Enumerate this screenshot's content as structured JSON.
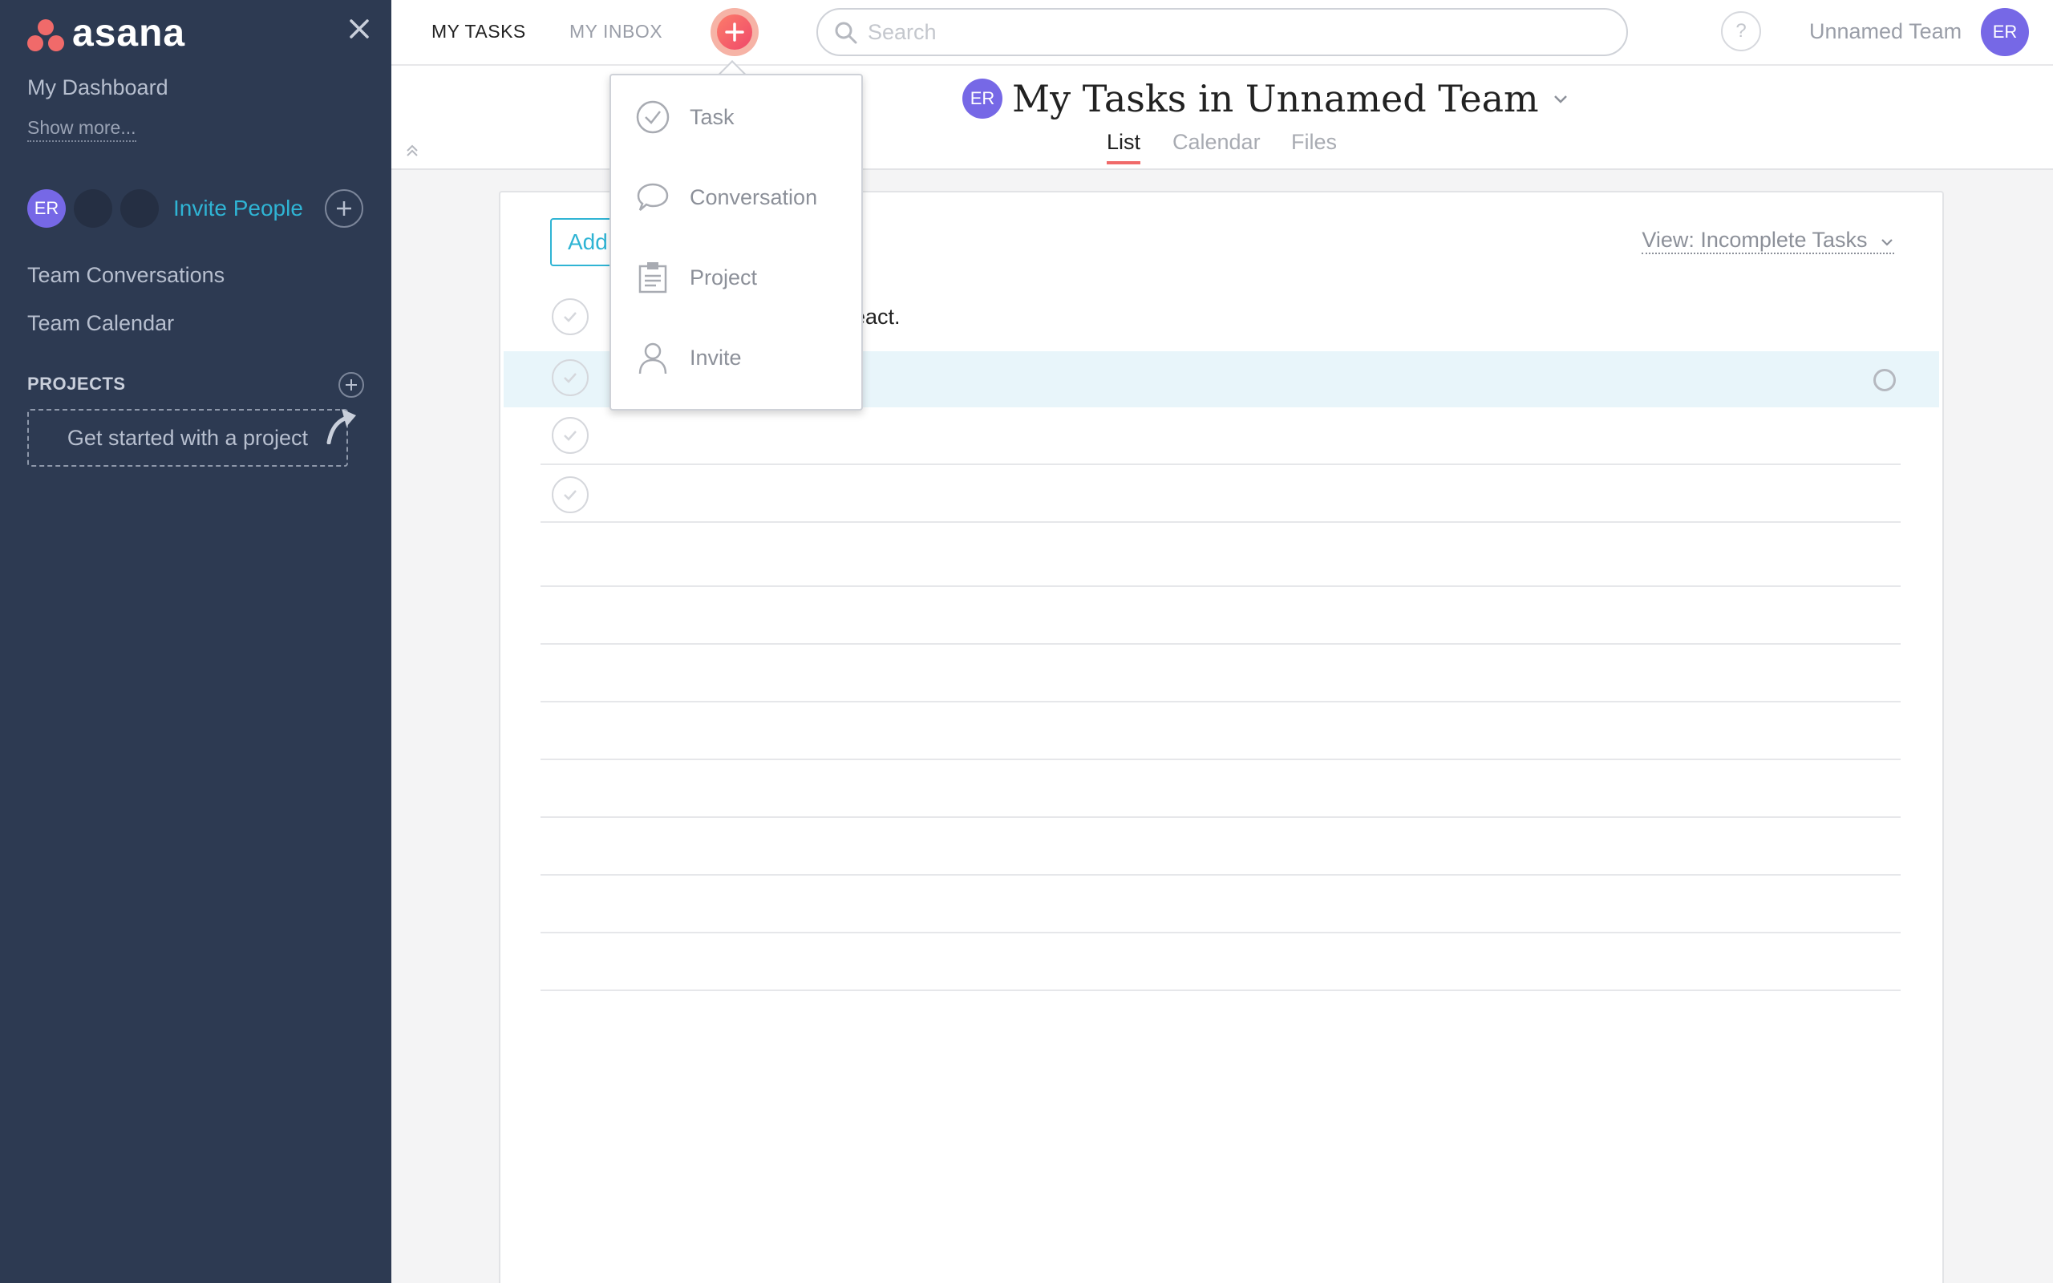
{
  "sidebar": {
    "logo_text": "asana",
    "my_dashboard": "My Dashboard",
    "show_more": "Show more...",
    "user_initials": "ER",
    "invite_people": "Invite People",
    "team_conversations": "Team Conversations",
    "team_calendar": "Team Calendar",
    "projects_header": "PROJECTS",
    "project_cta": "Get started with a project"
  },
  "topbar": {
    "my_tasks": "MY TASKS",
    "my_inbox": "MY INBOX",
    "search_placeholder": "Search",
    "help": "?",
    "team_name": "Unnamed Team",
    "user_initials": "ER"
  },
  "page": {
    "avatar_initials": "ER",
    "title": "My Tasks in Unnamed Team",
    "tabs": [
      "List",
      "Calendar",
      "Files"
    ],
    "active_tab": "List"
  },
  "tasks": {
    "add_button": "Add",
    "view_filter": "View: Incomplete Tasks",
    "rows": [
      {
        "text": "eact."
      },
      {
        "text": ""
      },
      {
        "text": ""
      },
      {
        "text": ""
      }
    ]
  },
  "add_menu": {
    "items": [
      {
        "label": "Task",
        "icon": "check-circle-icon"
      },
      {
        "label": "Conversation",
        "icon": "speech-bubble-icon"
      },
      {
        "label": "Project",
        "icon": "clipboard-icon"
      },
      {
        "label": "Invite",
        "icon": "person-icon"
      }
    ]
  },
  "colors": {
    "sidebar_bg": "#2d3a52",
    "accent": "#2fb4d4",
    "brand": "#f06a6a",
    "avatar": "#7668e6"
  }
}
